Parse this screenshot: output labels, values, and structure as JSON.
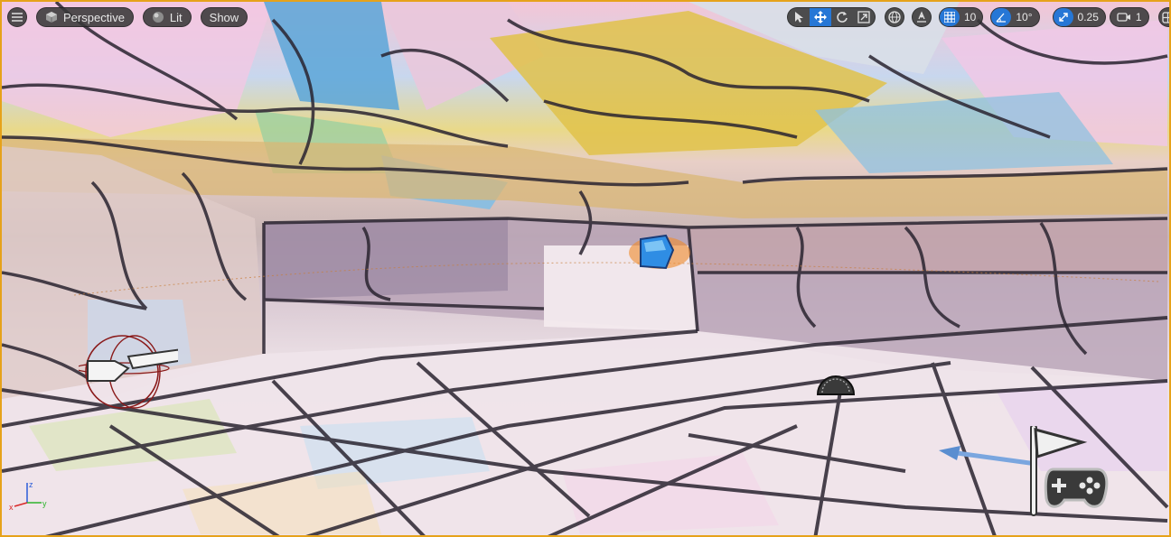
{
  "viewport": {
    "menu_icon": "hamburger-icon",
    "perspective": {
      "label": "Perspective",
      "icon": "cube-icon"
    },
    "lit": {
      "label": "Lit",
      "icon": "sphere-icon"
    },
    "show": {
      "label": "Show"
    },
    "transform_tools": [
      "select-arrow-icon",
      "move-icon",
      "rotate-icon",
      "scale-icon"
    ],
    "active_tool": "move-icon",
    "world_local_icon": "globe-icon",
    "surface_snap_icon": "surface-snap-icon",
    "grid_snap": {
      "icon": "grid-icon",
      "value": "10"
    },
    "rotation_snap": {
      "icon": "angle-icon",
      "value": "10°"
    },
    "scale_snap": {
      "icon": "scale-arrow-icon",
      "value": "0.25"
    },
    "camera_speed": {
      "icon": "camera-icon",
      "value": "1"
    },
    "layout_icon": "maximize-layout-icon",
    "accent_color": "#2677d6",
    "border_color": "#e6a21a"
  }
}
